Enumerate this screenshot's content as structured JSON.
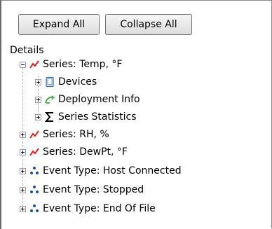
{
  "toolbar": {
    "expand_all_label": "Expand All",
    "collapse_all_label": "Collapse All"
  },
  "tree": {
    "root_label": "Details",
    "nodes": [
      {
        "label": "Series: Temp, °F",
        "icon": "series-line-icon",
        "expanded": true,
        "children": [
          {
            "label": "Devices",
            "icon": "device-icon"
          },
          {
            "label": "Deployment Info",
            "icon": "deployment-icon"
          },
          {
            "label": "Series Statistics",
            "icon": "sigma-icon"
          }
        ]
      },
      {
        "label": "Series: RH, %",
        "icon": "series-line-icon",
        "expanded": false
      },
      {
        "label": "Series: DewPt, °F",
        "icon": "series-line-icon",
        "expanded": false
      },
      {
        "label": "Event Type: Host Connected",
        "icon": "event-dots-icon",
        "expanded": false
      },
      {
        "label": "Event Type: Stopped",
        "icon": "event-dots-icon",
        "expanded": false
      },
      {
        "label": "Event Type: End Of File",
        "icon": "event-dots-icon",
        "expanded": false
      }
    ]
  },
  "colors": {
    "series_line": "#e02020",
    "event_dots": "#1a4f9c",
    "device_icon": "#3a6ea5",
    "deployment_icon": "#4caf50"
  }
}
